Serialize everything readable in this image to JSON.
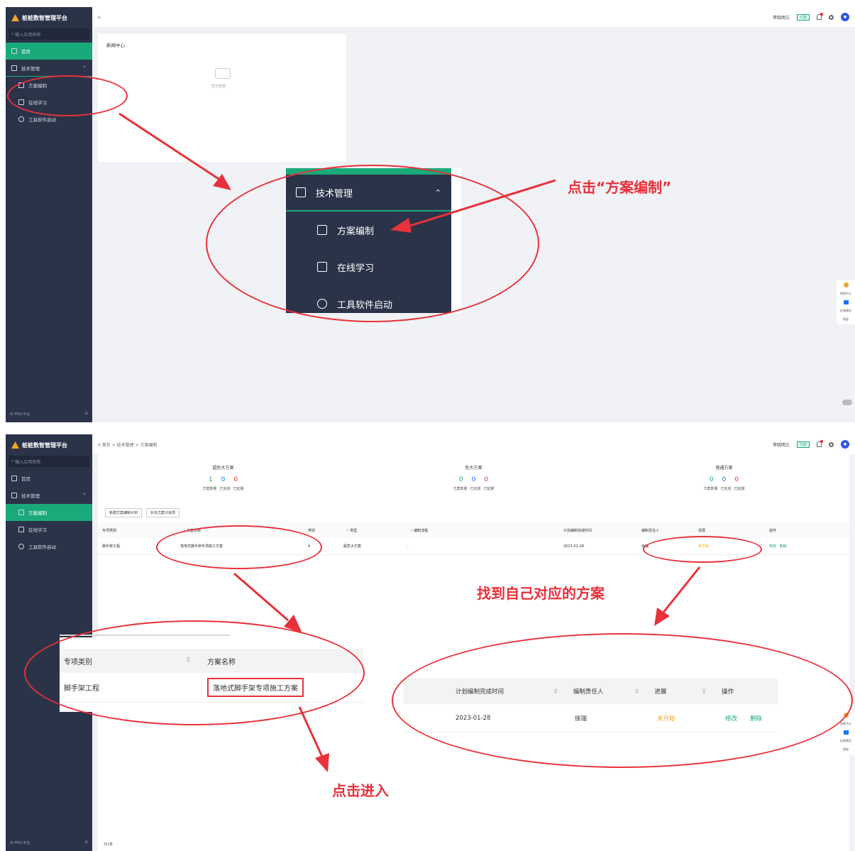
{
  "app": {
    "title": "桩桩数智管理平台",
    "search_placeholder": "输入应用名称",
    "footer_left": "Ai PRO.平台",
    "footer_icon": "collapse-icon"
  },
  "panel1": {
    "sidebar": {
      "home": "首页",
      "group": "技术管理",
      "items": [
        "方案编制",
        "在线学习",
        "工具软件启动"
      ]
    },
    "topbar": {
      "user": "李晓明三",
      "tag": "已验"
    },
    "news": {
      "title": "新闻中心",
      "empty": "暂无数据"
    },
    "float": {
      "help": "帮助中心",
      "feedback": "反馈建议",
      "collect": "收起"
    },
    "zoom": {
      "group": "技术管理",
      "items": [
        "方案编制",
        "在线学习",
        "工具软件启动"
      ]
    },
    "callout": "点击“方案编制”"
  },
  "panel2": {
    "breadcrumb": "首页 > 技术管理 > 方案编制",
    "sidebar": {
      "home": "首页",
      "group": "技术管理",
      "items": [
        "方案编制",
        "在线学习",
        "工具软件启动"
      ]
    },
    "topbar": {
      "user": "李晓明三",
      "tag": "已验"
    },
    "stats": [
      {
        "title": "超危大方案",
        "nums": [
          "1",
          "0",
          "0"
        ],
        "labels": [
          "方案数量",
          "已完成",
          "已延期"
        ]
      },
      {
        "title": "危大方案",
        "nums": [
          "0",
          "0",
          "0"
        ],
        "labels": [
          "方案数量",
          "已完成",
          "已延期"
        ]
      },
      {
        "title": "普通方案",
        "nums": [
          "0",
          "0",
          "0"
        ],
        "labels": [
          "方案数量",
          "已完成",
          "已延期"
        ]
      }
    ],
    "buttons": [
      "新建方案编制计划",
      "补充方案计划项"
    ],
    "table": {
      "headers": [
        "专项类别",
        "方案名称",
        "类别",
        "类型",
        "编制流程",
        "计划编制完成时间",
        "编制责任人",
        "进展",
        "操作"
      ],
      "row": {
        "category": "脚手架工程",
        "name": "落地式脚手架专项施工方案",
        "cls": "A",
        "type": "超危大方案",
        "flow": "-",
        "date": "2023-01-28",
        "owner": "徐瑞",
        "progress": "未开始",
        "edit": "修改",
        "delete": "删除"
      }
    },
    "pager": "共1条",
    "zoom_left": {
      "h1": "专项类别",
      "h2": "方案名称",
      "category": "脚手架工程",
      "name": "落地式脚手架专项施工方案"
    },
    "zoom_right": {
      "h1": "计划编制完成时间",
      "h2": "编制责任人",
      "h3": "进展",
      "h4": "操作",
      "date": "2023-01-28",
      "owner": "徐瑞",
      "progress": "未开始",
      "edit": "修改",
      "delete": "删除"
    },
    "callout_find": "找到自己对应的方案",
    "callout_click": "点击进入"
  }
}
